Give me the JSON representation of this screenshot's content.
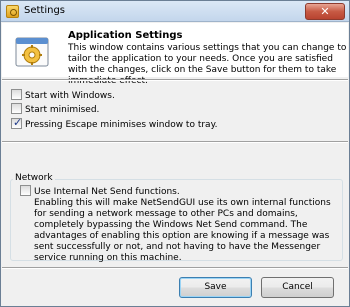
{
  "window": {
    "title": "Settings",
    "close_glyph": "✕"
  },
  "header": {
    "title": "Application Settings",
    "description": "This window contains various settings that you can change to tailor the application to your needs. Once you are satisfied with the changes, click on the Save button for them to take immediate effect.",
    "icon": "settings-window-icon"
  },
  "options": [
    {
      "label": "Start with Windows.",
      "checked": false
    },
    {
      "label": "Start minimised.",
      "checked": false
    },
    {
      "label": "Pressing Escape minimises window to tray.",
      "checked": true
    }
  ],
  "network": {
    "group_label": "Network",
    "option_label": "Use Internal Net Send functions.",
    "option_checked": false,
    "description": "Enabling this will make NetSendGUI use its own internal functions for sending a network message to other PCs and domains, completely bypassing the Windows Net Send command. The advantages of enabling this option are knowing if a message was sent successfully or not, and not having to have the Messenger service running on this machine."
  },
  "buttons": {
    "save": "Save",
    "cancel": "Cancel"
  },
  "colors": {
    "accent": "#3c7fb1",
    "close_button": "#c75a44",
    "icon_yellow": "#e0a21d"
  }
}
